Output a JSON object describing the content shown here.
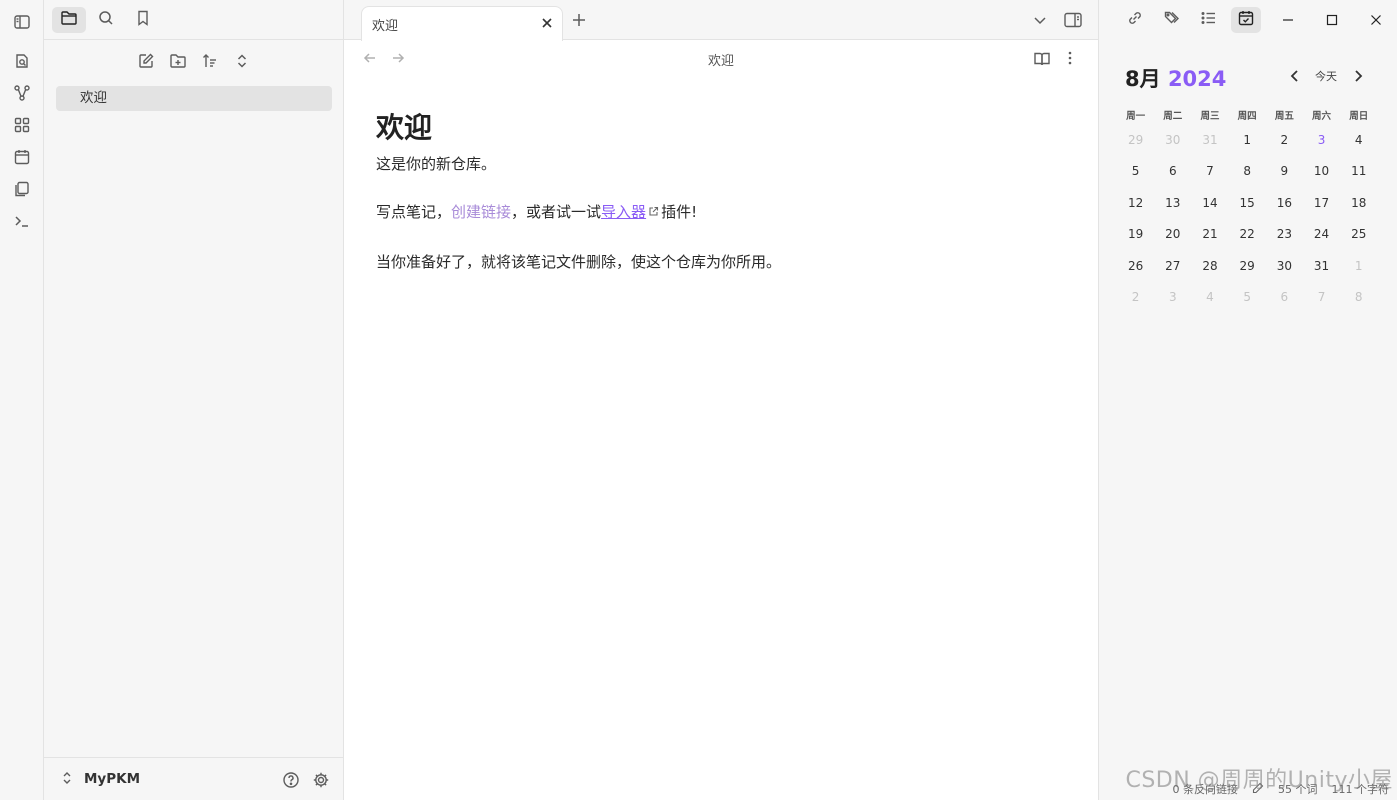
{
  "left_topbar": {
    "sidebar_toggle_icon": "sidebar-toggle-icon",
    "tabs": [
      {
        "icon": "folder-icon",
        "active": true
      },
      {
        "icon": "search-icon",
        "active": false
      },
      {
        "icon": "bookmark-icon",
        "active": false
      }
    ]
  },
  "ribbon": {
    "items": [
      "open-quick-switcher-icon",
      "graph-view-icon",
      "canvas-icon",
      "daily-note-icon",
      "templates-icon",
      "command-palette-icon"
    ]
  },
  "file_explorer": {
    "actions": [
      "new-note-icon",
      "new-folder-icon",
      "sort-icon",
      "collapse-icon"
    ],
    "files": [
      {
        "name": "欢迎",
        "selected": true
      }
    ]
  },
  "vault": {
    "name": "MyPKM"
  },
  "tab": {
    "title": "欢迎"
  },
  "view_header": {
    "title": "欢迎"
  },
  "note": {
    "heading": "欢迎",
    "line1": "这是你的新仓库。",
    "line2_pre": "写点笔记，",
    "line2_link": "创建链接",
    "line2_mid": "，或者试一试",
    "line2_ext_link": "导入器",
    "line2_post": "插件!",
    "line3": "当你准备好了，就将该笔记文件删除，使这个仓库为你所用。"
  },
  "calendar": {
    "month_label": "8月",
    "year_label": "2024",
    "today_label": "今天",
    "weekdays": [
      "周一",
      "周二",
      "周三",
      "周四",
      "周五",
      "周六",
      "周日"
    ],
    "weeks": [
      [
        {
          "d": "29",
          "a": true
        },
        {
          "d": "30",
          "a": true
        },
        {
          "d": "31",
          "a": true
        },
        {
          "d": "1"
        },
        {
          "d": "2"
        },
        {
          "d": "3",
          "t": true
        },
        {
          "d": "4"
        }
      ],
      [
        {
          "d": "5"
        },
        {
          "d": "6"
        },
        {
          "d": "7"
        },
        {
          "d": "8"
        },
        {
          "d": "9"
        },
        {
          "d": "10"
        },
        {
          "d": "11"
        }
      ],
      [
        {
          "d": "12"
        },
        {
          "d": "13"
        },
        {
          "d": "14"
        },
        {
          "d": "15"
        },
        {
          "d": "16"
        },
        {
          "d": "17"
        },
        {
          "d": "18"
        }
      ],
      [
        {
          "d": "19"
        },
        {
          "d": "20"
        },
        {
          "d": "21"
        },
        {
          "d": "22"
        },
        {
          "d": "23"
        },
        {
          "d": "24"
        },
        {
          "d": "25"
        }
      ],
      [
        {
          "d": "26"
        },
        {
          "d": "27"
        },
        {
          "d": "28"
        },
        {
          "d": "29"
        },
        {
          "d": "30"
        },
        {
          "d": "31"
        },
        {
          "d": "1",
          "a": true
        }
      ],
      [
        {
          "d": "2",
          "a": true
        },
        {
          "d": "3",
          "a": true
        },
        {
          "d": "4",
          "a": true
        },
        {
          "d": "5",
          "a": true
        },
        {
          "d": "6",
          "a": true
        },
        {
          "d": "7",
          "a": true
        },
        {
          "d": "8",
          "a": true
        }
      ]
    ]
  },
  "status": {
    "backlinks": "0 条反向链接",
    "words": "55 个词",
    "chars": "111 个字符"
  },
  "watermark": "CSDN @周周的Unity小屋",
  "colors": {
    "accent": "#8a5cf5",
    "internal_link": "#a88bd8"
  }
}
